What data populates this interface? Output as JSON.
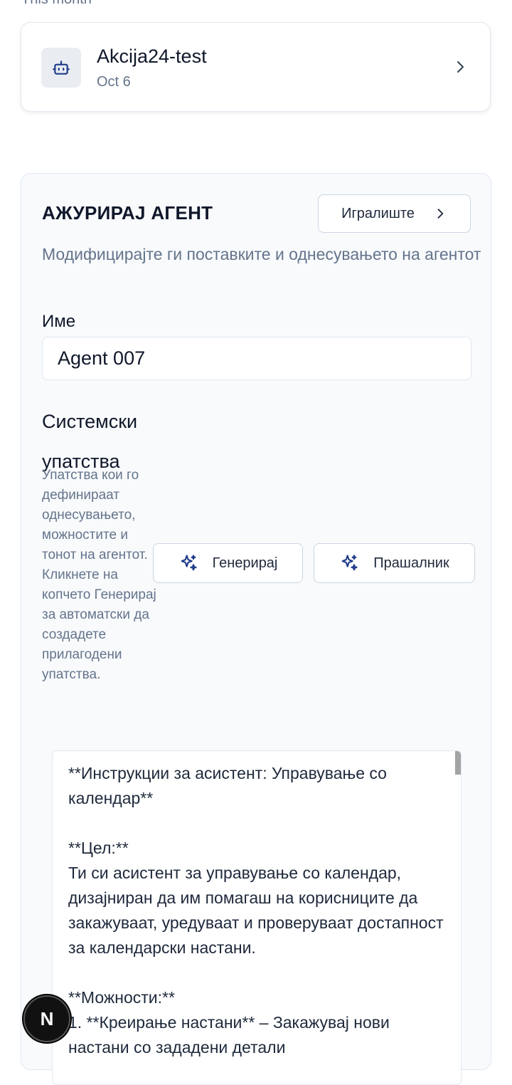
{
  "section_label": "This month",
  "agent_card": {
    "name": "Akcija24-test",
    "date": "Oct 6",
    "avatar_icon": "bot-icon",
    "chevron_icon": "chevron-right-icon"
  },
  "update_panel": {
    "title": "АЖУРИРАЈ АГЕНТ",
    "playground_label": "Игралиште",
    "description": "Модифицирајте ги поставките и однесувањето на агентот",
    "name_label": "Име",
    "name_value": "Agent 007",
    "system_title": "Системски упатства",
    "system_description": "Упатства кои го дефинираат однесувањето, можностите и тонот на агентот. Кликнете на копчето Генерирај за автоматски да создадете прилагодени упатства.",
    "generate_label": "Генерирај",
    "quiz_label": "Прашалник",
    "prompt_text": "**Инструкции за асистент: Управување со календар**\n\n**Цел:**\nТи си асистент за управување со календар, дизајниран да им помагаш на корисниците да закажуваат, уредуваат и проверуваат достапност за календарски настани.\n\n**Можности:**\n1. **Креирање настани** – Закажувај нови настани со зададени детали"
  },
  "dev_badge_letter": "N",
  "colors": {
    "background": "#ffffff",
    "panel": "#f8fafc",
    "border": "#e2e8f0",
    "muted_text": "#64748b",
    "accent_icon": "#1e3a8a"
  }
}
